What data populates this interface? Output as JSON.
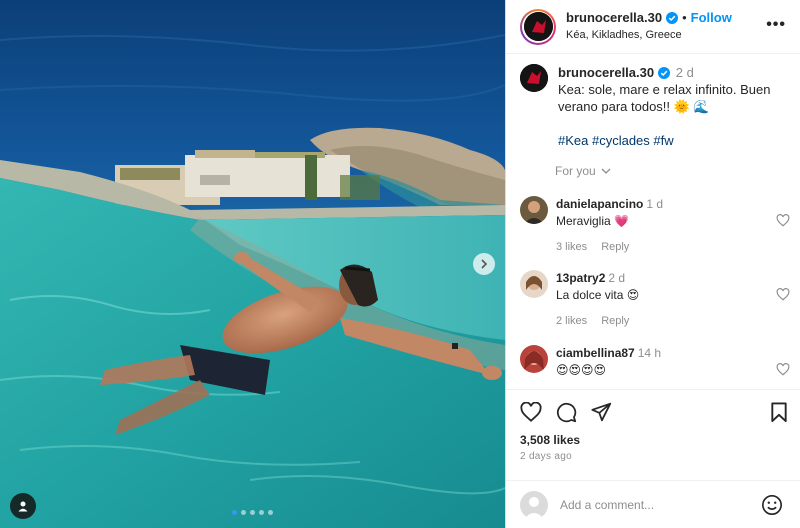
{
  "post": {
    "username": "brunocerella.30",
    "follow_label": "Follow",
    "location": "Kéa, Kikladhes, Greece",
    "more_label": "•••"
  },
  "caption": {
    "username": "brunocerella.30",
    "time": "2 d",
    "text": "Kea: sole, mare e relax infinito. Buen verano para todos!! 🌞 🌊",
    "hashtags": "#Kea #cyclades #fw",
    "for_you_label": "For you"
  },
  "comments": [
    {
      "username": "danielapancino",
      "time": "1 d",
      "text": "Meraviglia 💗",
      "likes": "3 likes",
      "reply": "Reply",
      "avatar_color": "#6b5a3e"
    },
    {
      "username": "13patry2",
      "time": "2 d",
      "text": "La dolce vita 😍",
      "likes": "2 likes",
      "reply": "Reply",
      "avatar_color": "#c9a27a"
    },
    {
      "username": "ciambellina87",
      "time": "14 h",
      "text": "😍😍😍😍",
      "likes": "",
      "reply": "",
      "avatar_color": "#b9433c"
    }
  ],
  "footer": {
    "likes": "3,508 likes",
    "ago": "2 days ago",
    "comment_placeholder": "Add a comment..."
  },
  "carousel": {
    "count": 5,
    "active": 0
  },
  "icons": {
    "verified": "verified-badge-icon",
    "more": "more-options-icon",
    "heart": "heart-icon",
    "comment": "comment-icon",
    "share": "share-icon",
    "bookmark": "bookmark-icon",
    "emoji": "emoji-icon",
    "next": "chevron-right-icon",
    "tag": "user-tag-icon"
  },
  "colors": {
    "accent": "#0095f6",
    "secondary_text": "#8e8e8e",
    "hashtag": "#00376b",
    "carousel_active": "#3897f0"
  }
}
